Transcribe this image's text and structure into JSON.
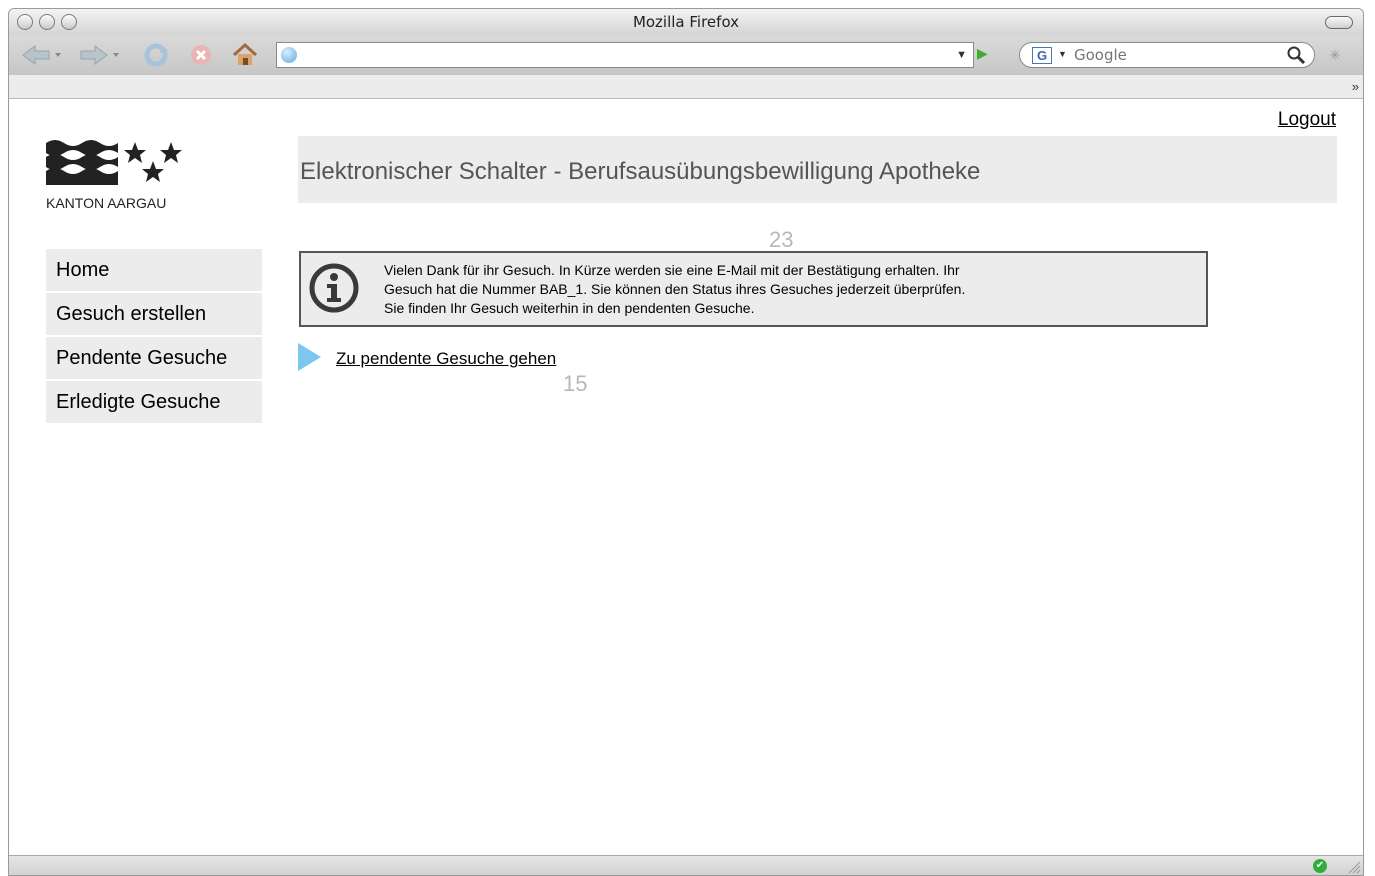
{
  "window": {
    "title": "Mozilla Firefox"
  },
  "toolbar": {
    "search_engine_label": "G",
    "search_placeholder": "Google",
    "url_value": ""
  },
  "page": {
    "logout_label": "Logout",
    "logo_text": "KANTON AARGAU",
    "header_title": "Elektronischer Schalter - Berufsausübungsbewilligung Apotheke",
    "annotation_top": "23",
    "annotation_bottom": "15",
    "nav": [
      {
        "label": "Home"
      },
      {
        "label": "Gesuch erstellen"
      },
      {
        "label": "Pendente Gesuche"
      },
      {
        "label": "Erledigte Gesuche"
      }
    ],
    "info": {
      "line1": "Vielen Dank für ihr Gesuch. In Kürze werden sie eine E-Mail mit der Bestätigung erhalten. Ihr",
      "line2": "Gesuch hat die Nummer BAB_1. Sie können den Status ihres Gesuches jederzeit überprüfen.",
      "line3": "Sie finden Ihr Gesuch weiterhin in den pendenten Gesuche."
    },
    "action_link": "Zu pendente Gesuche gehen"
  },
  "colors": {
    "accent_arrow": "#7cc6ef",
    "panel_bg": "#ececec",
    "status_ok": "#2fae3a"
  }
}
